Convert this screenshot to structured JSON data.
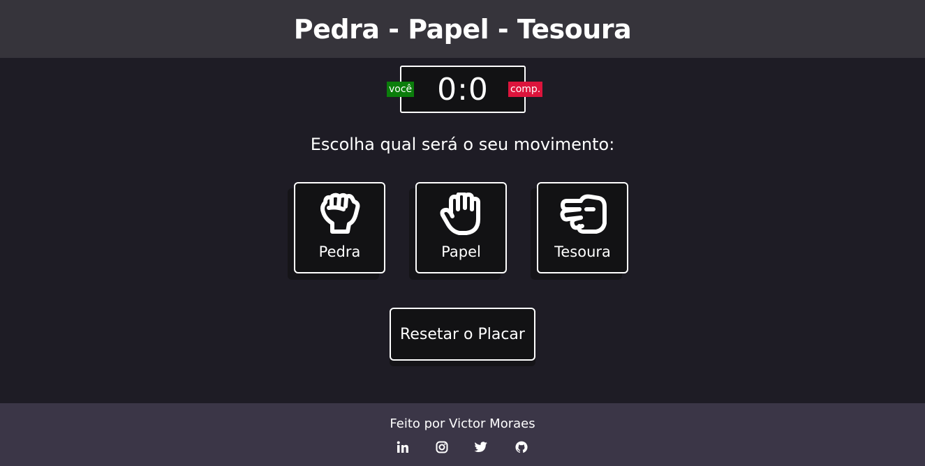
{
  "header": {
    "title": "Pedra - Papel - Tesoura"
  },
  "scoreboard": {
    "score": "0:0",
    "user_label": "você",
    "comp_label": "comp.",
    "user_color": "#0b7d0b",
    "comp_color": "#dc143c"
  },
  "prompt": "Escolha qual será o seu movimento:",
  "choices": [
    {
      "label": "Pedra",
      "icon": "fist-icon"
    },
    {
      "label": "Papel",
      "icon": "open-hand-icon"
    },
    {
      "label": "Tesoura",
      "icon": "scissors-hand-icon"
    }
  ],
  "reset_label": "Resetar o Placar",
  "footer": {
    "credit": "Feito por Victor Moraes",
    "social": [
      {
        "name": "linkedin-icon"
      },
      {
        "name": "instagram-icon"
      },
      {
        "name": "twitter-icon"
      },
      {
        "name": "github-icon"
      }
    ]
  }
}
